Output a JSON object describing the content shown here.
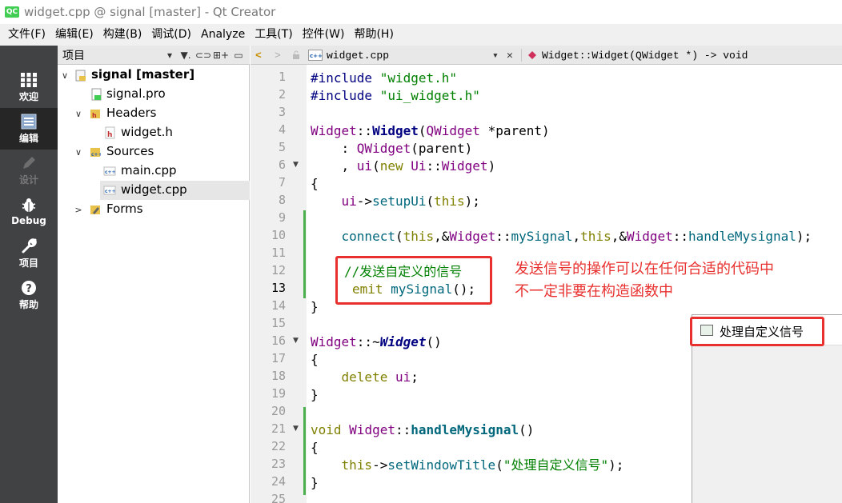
{
  "window": {
    "title": "widget.cpp @ signal [master] - Qt Creator",
    "app_icon": "QC"
  },
  "menu": [
    "文件(F)",
    "编辑(E)",
    "构建(B)",
    "调试(D)",
    "Analyze",
    "工具(T)",
    "控件(W)",
    "帮助(H)"
  ],
  "modes": [
    {
      "label": "欢迎",
      "icon": "grid-icon"
    },
    {
      "label": "编辑",
      "icon": "document-icon"
    },
    {
      "label": "设计",
      "icon": "pencil-icon"
    },
    {
      "label": "Debug",
      "icon": "bug-icon"
    },
    {
      "label": "项目",
      "icon": "wrench-icon"
    },
    {
      "label": "帮助",
      "icon": "help-icon"
    }
  ],
  "project_panel": {
    "title": "项目",
    "arrow": "▾",
    "filter": "▼.",
    "link": "⊂⊃",
    "split": "⊞+",
    "close": "▭"
  },
  "tree": [
    {
      "label": "signal [master]",
      "arrow": "∨"
    },
    {
      "label": "signal.pro",
      "arrow": ""
    },
    {
      "label": "Headers",
      "arrow": "∨"
    },
    {
      "label": "widget.h",
      "arrow": ""
    },
    {
      "label": "Sources",
      "arrow": "∨"
    },
    {
      "label": "main.cpp",
      "arrow": ""
    },
    {
      "label": "widget.cpp",
      "arrow": ""
    },
    {
      "label": "Forms",
      "arrow": ">"
    }
  ],
  "editor": {
    "back": "<",
    "forward": ">",
    "file": "widget.cpp",
    "file_arrow": "▾",
    "close": "✕",
    "symbol": "Widget::Widget(QWidget *) -> void",
    "lines": [
      "1",
      "2",
      "3",
      "4",
      "5",
      "6",
      "7",
      "8",
      "9",
      "10",
      "11",
      "12",
      "13",
      "14",
      "15",
      "16",
      "17",
      "18",
      "19",
      "20",
      "21",
      "22",
      "23",
      "24",
      "25"
    ],
    "fold_marker": "▼"
  },
  "code": {
    "l1a": "#include ",
    "l1b": "\"widget.h\"",
    "l2a": "#include ",
    "l2b": "\"ui_widget.h\"",
    "l4a": "Widget",
    "l4b": "::",
    "l4c": "Widget",
    "l4d": "(",
    "l4e": "QWidget",
    " l4f": "",
    "l4g": " *parent)",
    "l5a": "    : ",
    "l5b": "QWidget",
    "l5c": "(parent)",
    "l6a": "    , ",
    "l6b": "ui",
    "l6c": "(",
    "l6d": "new ",
    "l6e": "Ui",
    "l6f": "::",
    "l6g": "Widget",
    "l6h": ")",
    "l7": "{",
    "l8a": "    ",
    "l8b": "ui",
    "l8c": "->",
    "l8d": "setupUi",
    "l8e": "(",
    "l8f": "this",
    "l8g": ");",
    "l10a": "    ",
    "l10b": "connect",
    "l10c": "(",
    "l10d": "this",
    ",": ",",
    "l10e": ",&",
    "l10f": "Widget",
    "l10g": "::",
    "l10h": "mySignal",
    "l10i": ",",
    "l10j": "this",
    "l10k": ",&",
    "l10l": "Widget",
    "l10m": "::",
    "l10n": "handleMysignal",
    "l10o": ");",
    "l12": "//发送自定义的信号",
    "l13a": "emit ",
    "l13b": "mySignal",
    "l13c": "();",
    "l14": "}",
    "l16a": "Widget",
    "l16b": "::~",
    "l16c": "Widget",
    "l16d": "()",
    "l17": "{",
    "l18a": "    ",
    "l18b": "delete ",
    "l18c": "ui",
    ";": ";",
    "l19": "}",
    "l21a": "void ",
    "l21b": "Widget",
    "l21c": "::",
    "l21d": "handleMysignal",
    "l21e": "()",
    "l22": "{",
    "l23a": "    ",
    "l23b": "this",
    "l23c": "->",
    "l23d": "setWindowTitle",
    "l23e": "(",
    "l23f": "\"处理自定义信号\"",
    "l23g": ");",
    "l24": "}"
  },
  "annotation": {
    "line1": "发送信号的操作可以在任何合适的代码中",
    "line2": "不一定非要在构造函数中"
  },
  "popup": {
    "title": "处理自定义信号"
  }
}
